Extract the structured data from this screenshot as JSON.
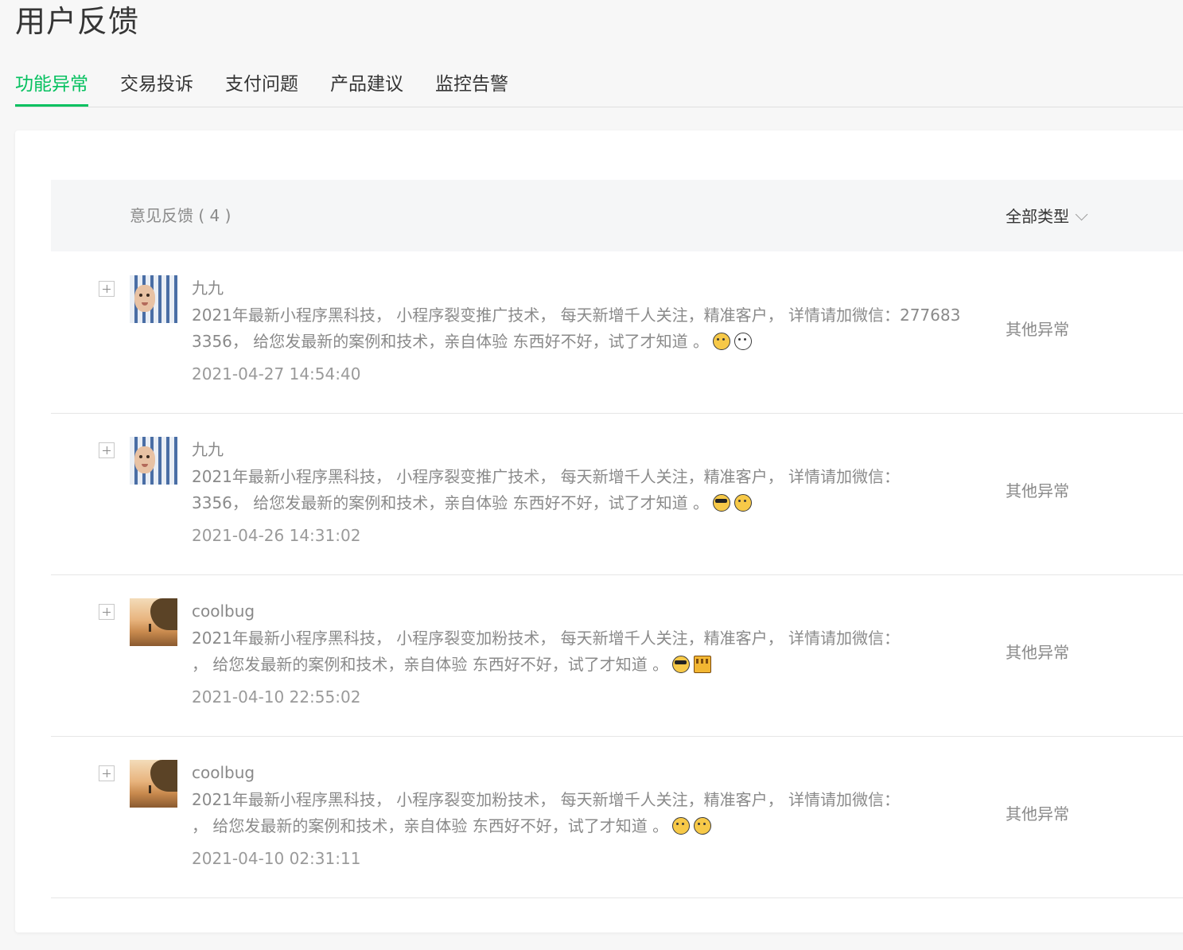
{
  "page": {
    "title": "用户反馈"
  },
  "tabs": [
    {
      "label": "功能异常",
      "active": true
    },
    {
      "label": "交易投诉",
      "active": false
    },
    {
      "label": "支付问题",
      "active": false
    },
    {
      "label": "产品建议",
      "active": false
    },
    {
      "label": "监控告警",
      "active": false
    }
  ],
  "list": {
    "title": "意见反馈 ( 4 )",
    "filter_label": "全部类型"
  },
  "feedback": [
    {
      "user": "九九",
      "avatar": "baby-photo",
      "line1": "2021年最新小程序黑科技， 小程序裂变推广技术， 每天新增千人关注，精准客户， 详情请加微信：277683",
      "line2": "3356， 给您发最新的案例和技术，亲自体验 东西好不好，试了才知道 。",
      "emojis": [
        "confused-face-icon",
        "clock-face-icon"
      ],
      "time": "2021-04-27 14:54:40",
      "category": "其他异常"
    },
    {
      "user": "九九",
      "avatar": "baby-photo",
      "line1": "2021年最新小程序黑科技， 小程序裂变推广技术， 每天新增千人关注，精准客户， 详情请加微信：",
      "line2": "3356， 给您发最新的案例和技术，亲自体验 东西好不好，试了才知道 。",
      "emojis": [
        "sunglasses-face-icon",
        "flushed-face-icon"
      ],
      "time": "2021-04-26 14:31:02",
      "category": "其他异常"
    },
    {
      "user": "coolbug",
      "avatar": "beach-photo",
      "line1": "2021年最新小程序黑科技， 小程序裂变加粉技术， 每天新增千人关注，精准客户， 详情请加微信：",
      "line2": "， 给您发最新的案例和技术，亲自体验 东西好不好，试了才知道 。",
      "emojis": [
        "sunglasses-face-icon",
        "crown-icon"
      ],
      "time": "2021-04-10 22:55:02",
      "category": "其他异常"
    },
    {
      "user": "coolbug",
      "avatar": "beach-photo",
      "line1": "2021年最新小程序黑科技， 小程序裂变加粉技术， 每天新增千人关注，精准客户， 详情请加微信：",
      "line2": "， 给您发最新的案例和技术，亲自体验 东西好不好，试了才知道 。",
      "emojis": [
        "kissing-face-icon",
        "laughing-cat-icon"
      ],
      "time": "2021-04-10 02:31:11",
      "category": "其他异常"
    }
  ],
  "colors": {
    "accent": "#07c160",
    "text": "#353535",
    "muted": "#8a8a8a",
    "header_bg": "#f5f6f7",
    "page_bg": "#f7f7f7"
  }
}
